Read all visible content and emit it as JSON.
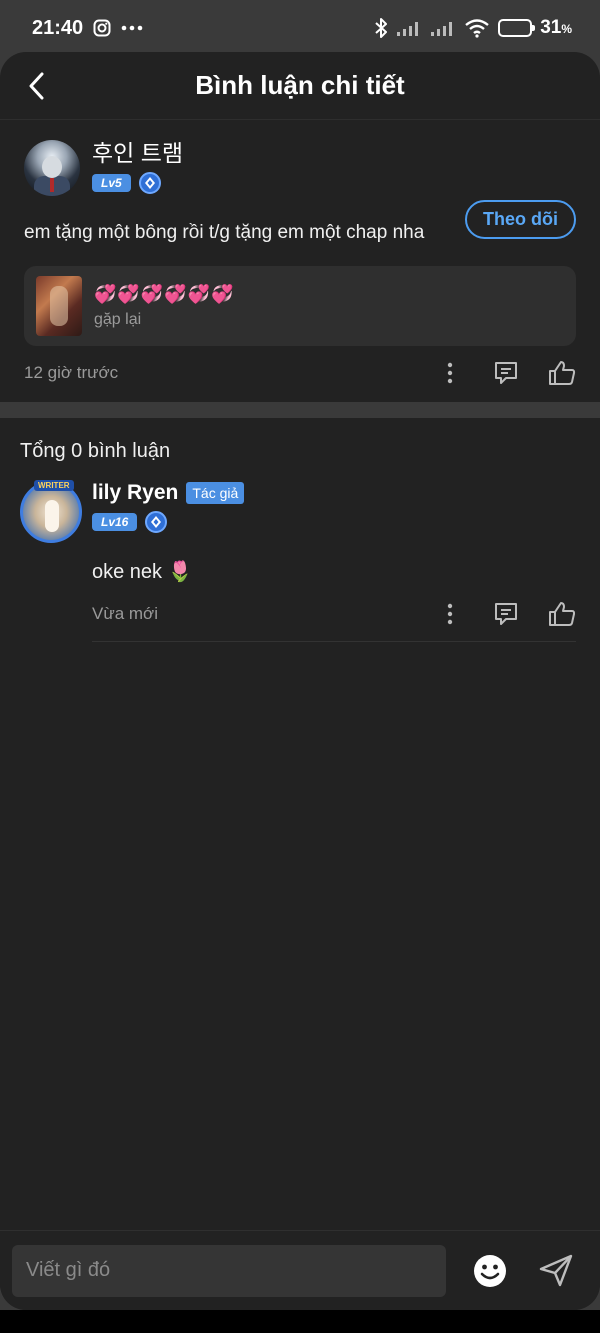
{
  "status_bar": {
    "time": "21:40",
    "battery_percent": "31",
    "battery_unit": "%",
    "icons": [
      "instagram-icon",
      "more-dots-icon",
      "bluetooth-icon",
      "signal-icon",
      "signal-icon",
      "wifi-icon",
      "battery-icon"
    ]
  },
  "header": {
    "title": "Bình luận chi tiết",
    "back_icon": "chevron-left-icon"
  },
  "main_comment": {
    "author_name": "후인 트램",
    "level": "Lv5",
    "follow_label": "Theo dõi",
    "text": "em tặng một bông rồi t/g tặng em một chap nha",
    "quote": {
      "emoji_line": "💞💞💞💞💞💞",
      "subtitle": "gặp lại"
    },
    "time": "12 giờ trước"
  },
  "replies": {
    "total_label": "Tổng 0 bình luận",
    "items": [
      {
        "author_name": "lily Ryen",
        "author_tag": "Tác giả",
        "avatar_tag": "WRITER",
        "level": "Lv16",
        "text": "oke nek 🌷",
        "time": "Vừa mới"
      }
    ]
  },
  "composer": {
    "placeholder": "Viết gì đó",
    "emoji_icon": "smiley-icon",
    "send_icon": "send-icon"
  },
  "colors": {
    "accent": "#4b8fe2",
    "follow_border": "#4c9cf0",
    "background": "#222222",
    "divider": "#3a3a3a"
  }
}
